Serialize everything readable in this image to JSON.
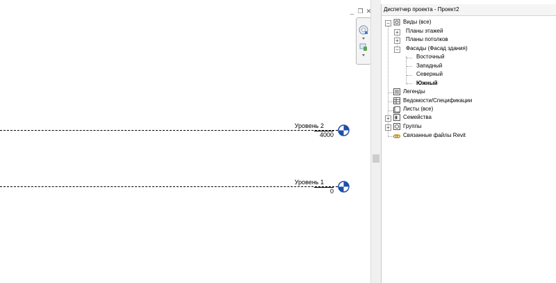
{
  "project_browser": {
    "title": "Диспетчер проекта - Проект2",
    "tree": [
      {
        "id": "views",
        "label": "Виды (все)",
        "icon": "views-icon",
        "expanded": true
      },
      {
        "id": "floor-plans",
        "label": "Планы этажей",
        "icon": "floor-plan-icon",
        "expanded": false
      },
      {
        "id": "ceiling-plans",
        "label": "Планы потолков",
        "icon": "ceiling-plan-icon",
        "expanded": false
      },
      {
        "id": "elevations",
        "label": "Фасады (Фасад здания)",
        "expanded": true
      },
      {
        "id": "east",
        "label": "Восточный"
      },
      {
        "id": "west",
        "label": "Западный"
      },
      {
        "id": "north",
        "label": "Северный"
      },
      {
        "id": "south",
        "label": "Южный",
        "selected": true
      },
      {
        "id": "legends",
        "label": "Легенды",
        "icon": "legend-icon"
      },
      {
        "id": "schedules",
        "label": "Ведомости/Спецификации",
        "icon": "schedule-icon"
      },
      {
        "id": "sheets",
        "label": "Листы (все)",
        "icon": "sheets-icon"
      },
      {
        "id": "families",
        "label": "Семейства",
        "icon": "families-icon",
        "expanded": false
      },
      {
        "id": "groups",
        "label": "Группы",
        "icon": "groups-icon",
        "expanded": false
      },
      {
        "id": "revit-links",
        "label": "Связанные файлы Revit",
        "icon": "link-icon"
      }
    ]
  },
  "levels": [
    {
      "name": "Уровень 2",
      "elevation": "4000"
    },
    {
      "name": "Уровень 1",
      "elevation": "0"
    }
  ],
  "colors": {
    "level_head": "#1f4fa8",
    "selection": "#000000"
  }
}
